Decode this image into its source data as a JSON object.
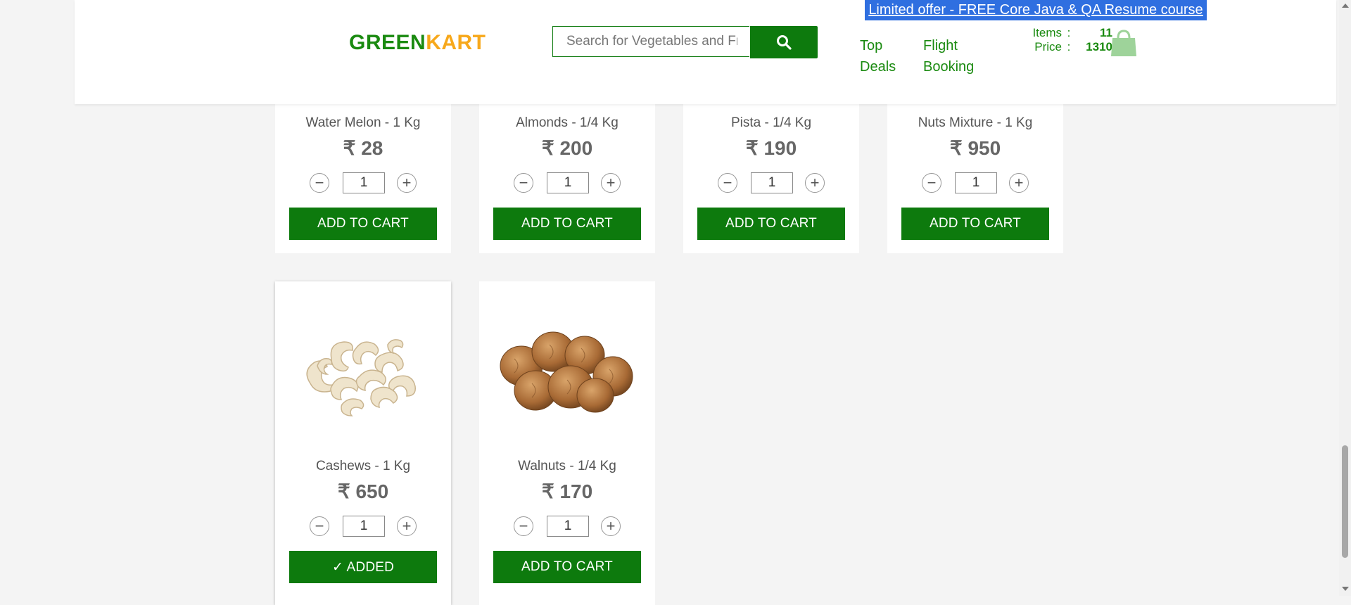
{
  "header": {
    "offer_banner": "Limited offer - FREE Core Java & QA Resume course",
    "logo_green": "GREEN",
    "logo_kart": "KART",
    "search_placeholder": "Search for Vegetables and Fruits",
    "nav": [
      {
        "label": "Top Deals"
      },
      {
        "label": "Flight Booking"
      }
    ],
    "cart": {
      "items_label": "Items",
      "items_value": "11",
      "price_label": "Price",
      "price_value": "1310",
      "separator": ":"
    }
  },
  "products": [
    {
      "name": "Water Melon - 1 Kg",
      "price": "₹ 28",
      "qty": "1",
      "button": "ADD TO CART"
    },
    {
      "name": "Almonds - 1/4 Kg",
      "price": "₹ 200",
      "qty": "1",
      "button": "ADD TO CART"
    },
    {
      "name": "Pista - 1/4 Kg",
      "price": "₹ 190",
      "qty": "1",
      "button": "ADD TO CART"
    },
    {
      "name": "Nuts Mixture - 1 Kg",
      "price": "₹ 950",
      "qty": "1",
      "button": "ADD TO CART"
    },
    {
      "name": "Cashews - 1 Kg",
      "price": "₹ 650",
      "qty": "1",
      "button": "✓ ADDED"
    },
    {
      "name": "Walnuts - 1/4 Kg",
      "price": "₹ 170",
      "qty": "1",
      "button": "ADD TO CART"
    }
  ],
  "icons": {
    "search": "search-icon",
    "cart": "shopping-bag-icon",
    "decrement": "minus-icon",
    "increment": "plus-icon"
  },
  "colors": {
    "brand_green": "#0d7a0d",
    "logo_orange": "#f7a81b",
    "banner_blue": "#2f6fe0",
    "cart_icon": "#9ed39a"
  }
}
